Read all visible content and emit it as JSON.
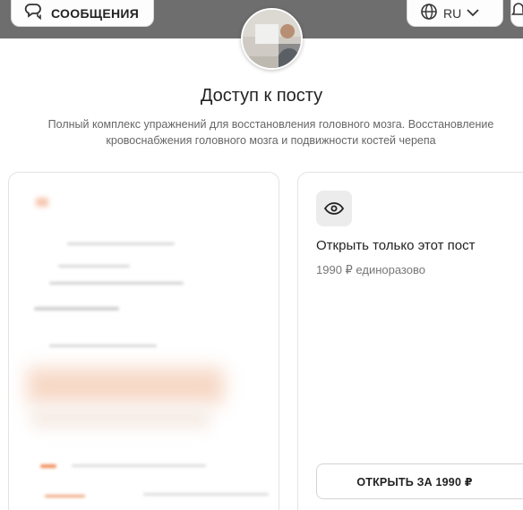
{
  "header": {
    "messages_label": "СООБЩЕНИЯ",
    "language_label": "RU",
    "icons": [
      "chat-bubbles-icon",
      "globe-icon",
      "chevron-down-icon",
      "bell-icon"
    ]
  },
  "main": {
    "title": "Доступ к посту",
    "description": "Полный комплекс упражнений для восстановления головного мозга. Восстановление кровоснабжения головного мозга и подвижности костей черепа"
  },
  "option": {
    "icon": "eye-icon",
    "title": "Открыть только этот пост",
    "price_text": "1990 ₽ единоразово",
    "button_label": "ОТКРЫТЬ ЗА 1990 ₽"
  },
  "colors": {
    "topbar": "#6e6e6e",
    "icon_bg": "#ececec",
    "accent_blur": "#f08c5a"
  }
}
